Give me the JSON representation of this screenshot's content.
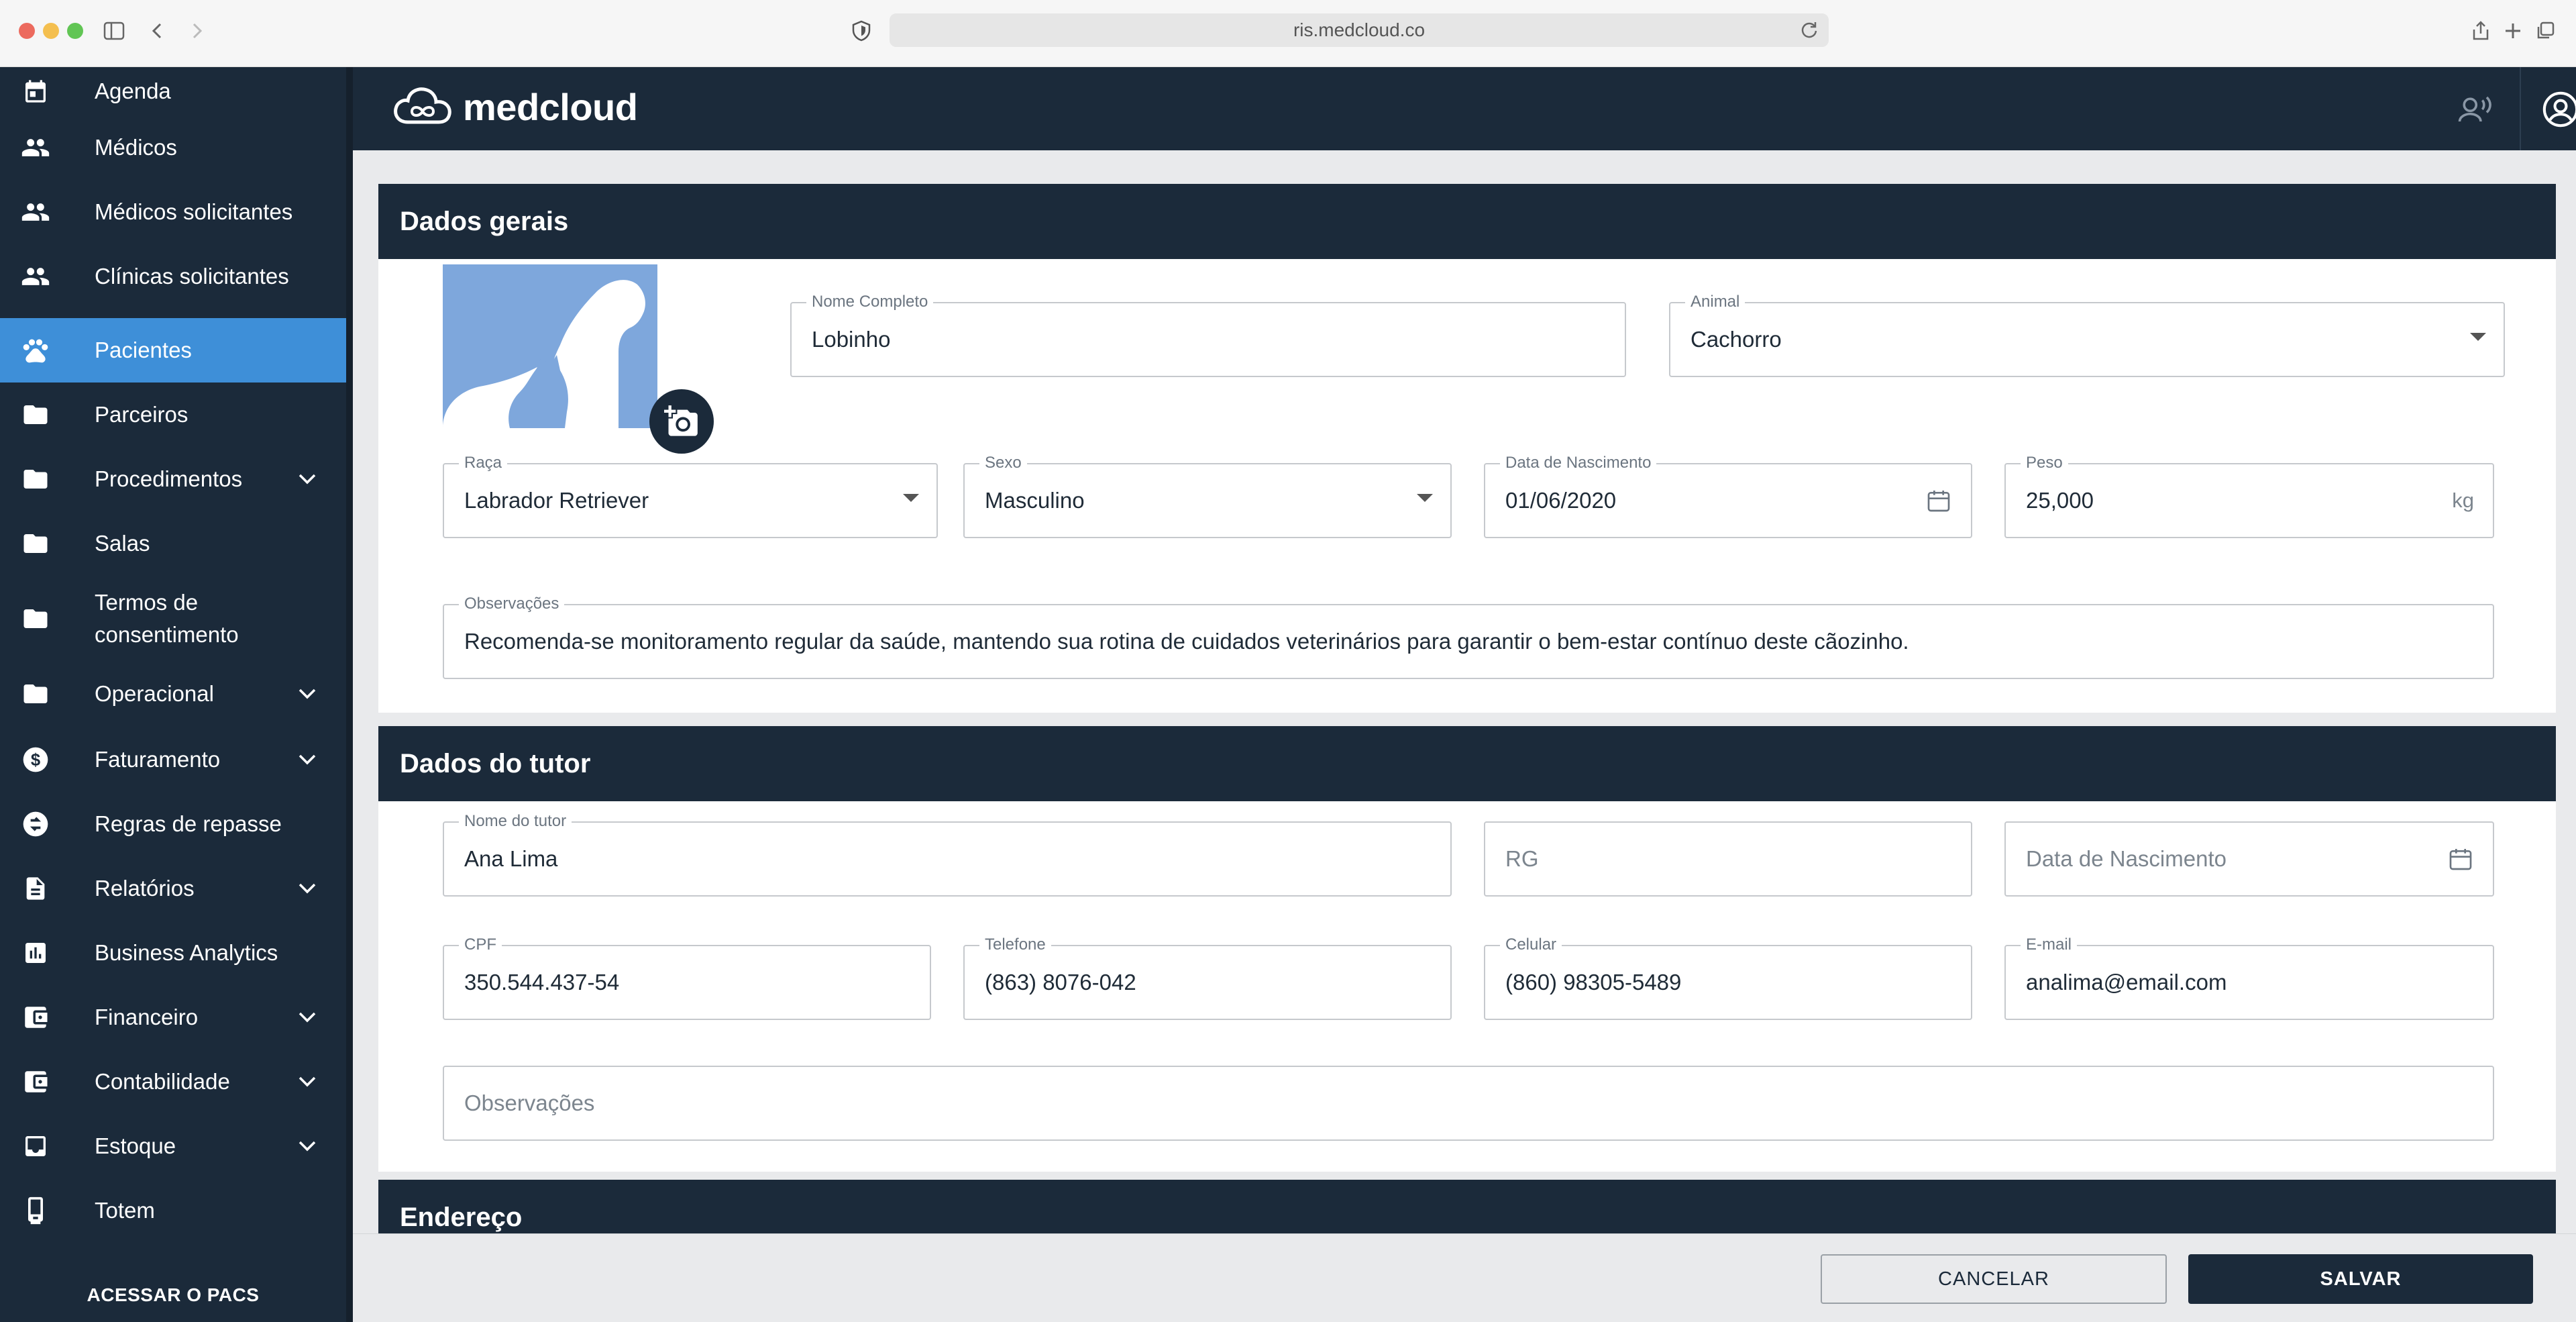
{
  "browser": {
    "url": "ris.medcloud.co"
  },
  "sidebar": {
    "items": [
      {
        "label": "Agenda",
        "icon": "calendar-icon"
      },
      {
        "label": "Médicos",
        "icon": "people-icon"
      },
      {
        "label": "Médicos solicitantes",
        "icon": "people-icon"
      },
      {
        "label": "Clínicas solicitantes",
        "icon": "people-icon"
      },
      {
        "label": "Pacientes",
        "icon": "paw-icon",
        "active": true
      },
      {
        "label": "Parceiros",
        "icon": "folder-icon"
      },
      {
        "label": "Procedimentos",
        "icon": "folder-icon",
        "expandable": true
      },
      {
        "label": "Salas",
        "icon": "folder-icon"
      },
      {
        "label_line1": "Termos de",
        "label_line2": "consentimento",
        "icon": "folder-icon"
      },
      {
        "label": "Operacional",
        "icon": "folder-icon",
        "expandable": true
      },
      {
        "label": "Faturamento",
        "icon": "dollar-icon",
        "expandable": true
      },
      {
        "label": "Regras de repasse",
        "icon": "repasse-icon"
      },
      {
        "label": "Relatórios",
        "icon": "document-icon",
        "expandable": true
      },
      {
        "label": "Business Analytics",
        "icon": "chart-icon"
      },
      {
        "label": "Financeiro",
        "icon": "wallet-icon",
        "expandable": true
      },
      {
        "label": "Contabilidade",
        "icon": "wallet-icon",
        "expandable": true
      },
      {
        "label": "Estoque",
        "icon": "inbox-icon",
        "expandable": true
      },
      {
        "label": "Totem",
        "icon": "kiosk-icon"
      }
    ],
    "pacs_label": "ACESSAR O PACS"
  },
  "header": {
    "logo_text": "medcloud"
  },
  "dados_gerais": {
    "title": "Dados gerais",
    "nome": {
      "label": "Nome Completo",
      "value": "Lobinho"
    },
    "animal": {
      "label": "Animal",
      "value": "Cachorro"
    },
    "raca": {
      "label": "Raça",
      "value": "Labrador Retriever"
    },
    "sexo": {
      "label": "Sexo",
      "value": "Masculino"
    },
    "nascimento": {
      "label": "Data de Nascimento",
      "value": "01/06/2020"
    },
    "peso": {
      "label": "Peso",
      "value": "25,000",
      "unit": "kg"
    },
    "observacoes": {
      "label": "Observações",
      "value": "Recomenda-se monitoramento regular da saúde, mantendo sua rotina de cuidados veterinários para garantir o bem-estar contínuo deste cãozinho."
    }
  },
  "dados_tutor": {
    "title": "Dados do tutor",
    "nome": {
      "label": "Nome do tutor",
      "value": "Ana Lima"
    },
    "rg": {
      "placeholder": "RG"
    },
    "nascimento": {
      "placeholder": "Data de Nascimento"
    },
    "cpf": {
      "label": "CPF",
      "value": "350.544.437-54"
    },
    "telefone": {
      "label": "Telefone",
      "value": "(863) 8076-042"
    },
    "celular": {
      "label": "Celular",
      "value": "(860) 98305-5489"
    },
    "email": {
      "label": "E-mail",
      "value": "analima@email.com"
    },
    "observacoes": {
      "placeholder": "Observações"
    }
  },
  "endereco": {
    "title": "Endereço"
  },
  "actions": {
    "cancel_label": "CANCELAR",
    "save_label": "SALVAR"
  },
  "colors": {
    "navy": "#1b2a3a",
    "active_blue": "#3e8fd8",
    "avatar_blue": "#7ea7dc"
  }
}
